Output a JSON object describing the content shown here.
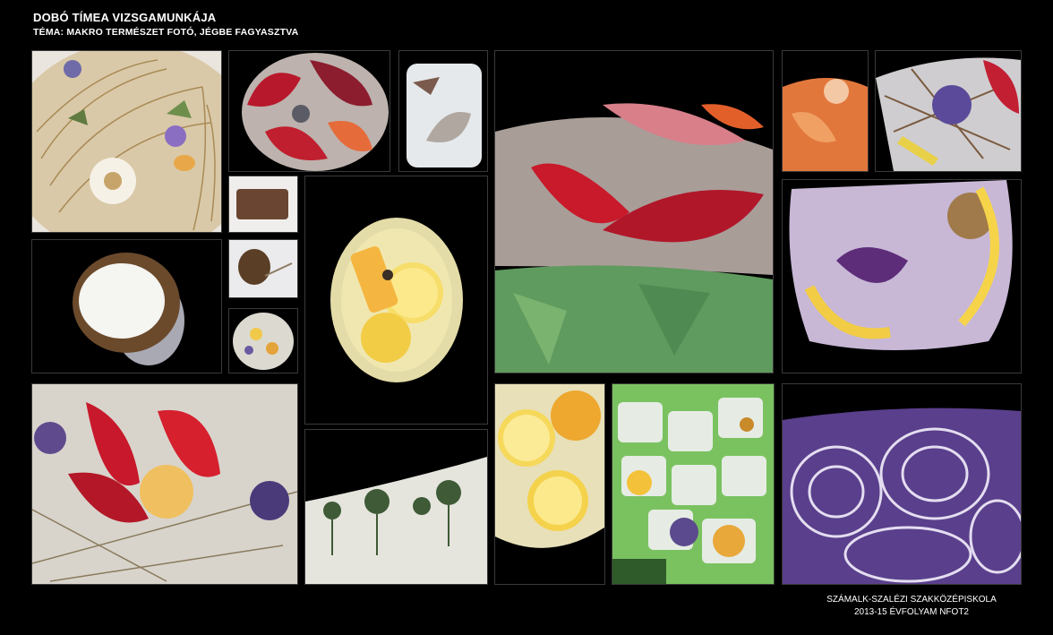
{
  "header": {
    "title": "DOBÓ TÍMEA VIZSGAMUNKÁJA",
    "subtitle": "TÉMA: MAKRO TERMÉSZET FOTÓ, JÉGBE FAGYASZTVA"
  },
  "footer": {
    "school": "SZÁMALK-SZALÉZI SZAKKÖZÉPISKOLA",
    "class": "2013-15 ÉVFOLYAM NFOT2"
  },
  "colors": {
    "background": "#000000",
    "frame": "#3a3a3a"
  },
  "photos": [
    {
      "subject": "dried grass and daisy in ice"
    },
    {
      "subject": "red petals in round ice"
    },
    {
      "subject": "leaf frozen in ice cube"
    },
    {
      "subject": "red petals and herbs in ice bowl"
    },
    {
      "subject": "orange petals in ice"
    },
    {
      "subject": "pansy and twigs in ice"
    },
    {
      "subject": "chocolate piece"
    },
    {
      "subject": "lemon slices in round ice"
    },
    {
      "subject": "coconut in ice"
    },
    {
      "subject": "pine cone in ice"
    },
    {
      "subject": "flowers in ice disc"
    },
    {
      "subject": "purple petals and lemon in ice"
    },
    {
      "subject": "tulip and herbs in ice"
    },
    {
      "subject": "plants in snow-like ice"
    },
    {
      "subject": "lemon slices in ice"
    },
    {
      "subject": "flower ice cubes"
    },
    {
      "subject": "red cabbage"
    }
  ]
}
